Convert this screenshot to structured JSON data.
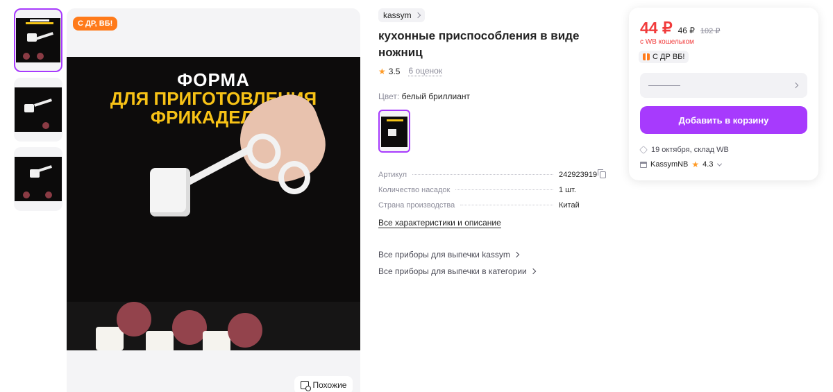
{
  "gallery": {
    "promo_badge": "С ДР, ВБ!",
    "photo_text": {
      "line1": "ФОРМА",
      "line2": "ДЛЯ ПРИГОТОВЛЕНИЯ",
      "line3": "ФРИКАДЕЛЕК"
    },
    "similar_label": "Похожие",
    "thumbnail_count": 3,
    "active_thumbnail": 1
  },
  "product": {
    "brand": "kassym",
    "title": "кухонные приспособления в виде ножниц",
    "rating": "3.5",
    "reviews": "6 оценок",
    "color_label": "Цвет:",
    "color_value": "белый бриллиант",
    "specs": [
      {
        "key": "Артикул",
        "value": "242923919"
      },
      {
        "key": "Количество насадок",
        "value": "1 шт."
      },
      {
        "key": "Страна производства",
        "value": "Китай"
      }
    ],
    "all_specs_link": "Все характеристики и описание",
    "related_links": [
      "Все приборы для выпечки kassym",
      "Все приборы для выпечки в категории"
    ]
  },
  "buy_box": {
    "price": "44 ₽",
    "price_without_wallet": "46 ₽",
    "price_old": "102 ₽",
    "wallet_note": "с WB кошельком",
    "promo_chip": "С ДР ВБ!",
    "size_placeholder": "",
    "add_to_cart": "Добавить в корзину",
    "delivery": "19 октября, склад WB",
    "seller_name": "KassymNB",
    "seller_rating": "4.3"
  },
  "colors": {
    "accent": "#a73afd",
    "price": "#f13b3b",
    "badge": "#ff7a1a",
    "star": "#ff9b27"
  },
  "icons": [
    "similar-search-icon",
    "chevron-right-icon",
    "star-icon",
    "copy-icon",
    "gift-icon",
    "box-icon",
    "shop-icon",
    "chevron-down-icon"
  ]
}
